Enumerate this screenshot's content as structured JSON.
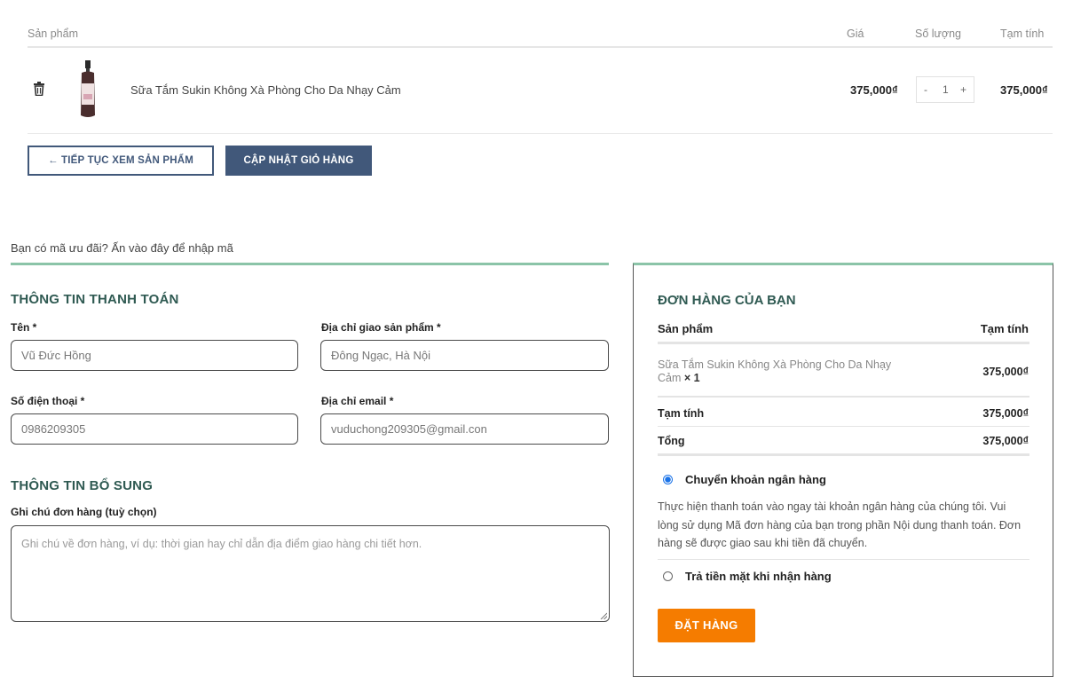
{
  "cart": {
    "headers": {
      "product": "Sản phẩm",
      "price": "Giá",
      "quantity": "Số lượng",
      "subtotal": "Tạm tính"
    },
    "items": [
      {
        "name": "Sữa Tắm Sukin Không Xà Phòng Cho Da Nhạy Cảm",
        "price": "375,000₫",
        "qty_minus": "-",
        "qty": "1",
        "qty_plus": "+",
        "subtotal": "375,000₫"
      }
    ],
    "continue_label": "← TIẾP TỤC XEM SẢN PHẨM",
    "update_label": "CẬP NHẬT GIỎ HÀNG"
  },
  "coupon_text": "Bạn có mã ưu đãi? Ấn vào đây để nhập mã",
  "billing": {
    "title": "THÔNG TIN THANH TOÁN",
    "name_label": "Tên *",
    "name_value": "Vũ Đức Hồng",
    "address_label": "Địa chỉ giao sản phẩm *",
    "address_value": "Đông Ngạc, Hà Nội",
    "phone_label": "Số điện thoại *",
    "phone_value": "0986209305",
    "email_label": "Địa chỉ email *",
    "email_value": "vuduchong209305@gmail.con"
  },
  "additional": {
    "title": "THÔNG TIN BỔ SUNG",
    "notes_label": "Ghi chú đơn hàng (tuỳ chọn)",
    "notes_placeholder": "Ghi chú về đơn hàng, ví dụ: thời gian hay chỉ dẫn địa điểm giao hàng chi tiết hơn."
  },
  "order": {
    "title": "ĐƠN HÀNG CỦA BẠN",
    "col_product": "Sản phẩm",
    "col_subtotal": "Tạm tính",
    "item_name_line1": "Sữa Tắm Sukin Không Xà Phòng Cho Da Nhạy",
    "item_name_line2": "Cảm",
    "item_qty": "× 1",
    "item_price": "375,000₫",
    "subtotal_label": "Tạm tính",
    "subtotal_value": "375,000₫",
    "total_label": "Tổng",
    "total_value": "375,000₫",
    "payment_bank_label": "Chuyển khoản ngân hàng",
    "payment_bank_desc": "Thực hiện thanh toán vào ngay tài khoản ngân hàng của chúng tôi. Vui lòng sử dụng Mã đơn hàng của bạn trong phần Nội dung thanh toán. Đơn hàng sẽ được giao sau khi tiền đã chuyển.",
    "payment_cod_label": "Trả tiền mặt khi nhận hàng",
    "place_order_label": "ĐẶT HÀNG"
  },
  "colors": {
    "brand_navy": "#41587a",
    "accent_green": "#8bc4a8",
    "heading_green": "#2f5a52",
    "order_orange": "#f57c00",
    "radio_blue": "#1a73e8"
  }
}
